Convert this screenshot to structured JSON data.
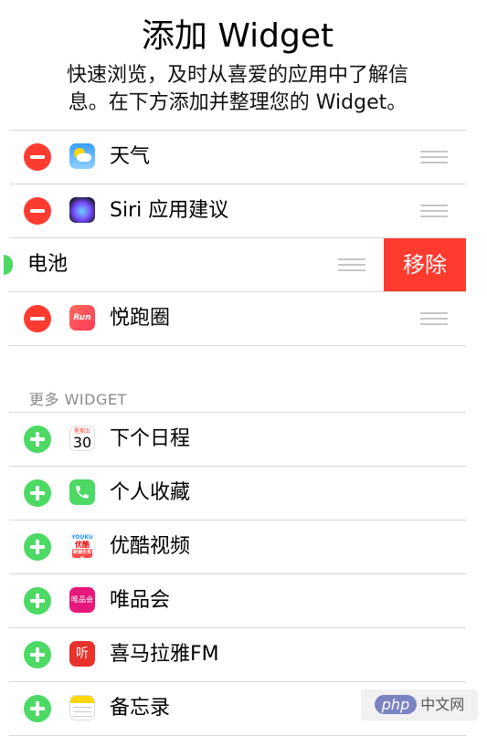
{
  "header": {
    "title": "添加 Widget",
    "subtitle_line1": "快速浏览，及时从喜爱的应用中了解信",
    "subtitle_line2": "息。在下方添加并整理您的 Widget。"
  },
  "active_widgets": [
    {
      "label": "天气",
      "icon": "weather-icon"
    },
    {
      "label": "Siri 应用建议",
      "icon": "siri-icon"
    },
    {
      "label": "电池",
      "icon": "battery-icon",
      "swiped": true,
      "action_label": "移除"
    },
    {
      "label": "悦跑圈",
      "icon": "yuepaoquan-icon",
      "icon_text": "Run"
    }
  ],
  "more_header": "更多 WIDGET",
  "more_widgets": [
    {
      "label": "下个日程",
      "icon": "calendar-icon",
      "icon_day": "30",
      "icon_dow": "星期五"
    },
    {
      "label": "个人收藏",
      "icon": "phone-icon"
    },
    {
      "label": "优酷视频",
      "icon": "youku-icon",
      "icon_text_top": "YOUKU",
      "icon_text_mid": "优酷",
      "icon_text_bottom": "新娱乐世界"
    },
    {
      "label": "唯品会",
      "icon": "vipshop-icon",
      "icon_text": "唯品会"
    },
    {
      "label": "喜马拉雅FM",
      "icon": "ximalaya-icon",
      "icon_text": "听"
    },
    {
      "label": "备忘录",
      "icon": "notes-icon"
    }
  ],
  "watermark": {
    "brand": "php",
    "text": "中文网"
  },
  "colors": {
    "remove": "#ff3b30",
    "add": "#4cd964",
    "separator": "#d8d8d8"
  }
}
